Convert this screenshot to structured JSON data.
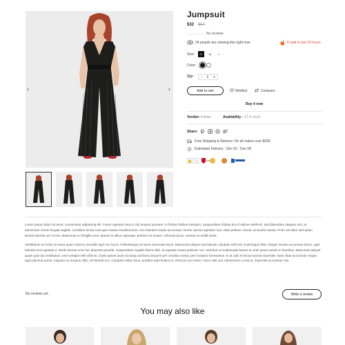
{
  "product": {
    "title": "Jumpsuit",
    "price": "$32",
    "old_price": "$54",
    "rating_stars": "☆☆☆☆☆",
    "reviews_label": "No reviews",
    "viewing_text": "24 people are viewing this right now",
    "sold_text": "6 sold in last 24 hours",
    "size_label": "Size:",
    "sizes": [
      "S",
      "M",
      "L"
    ],
    "color_label": "Color:",
    "qty_label": "Qty:",
    "qty_value": "1",
    "qty_minus": "-",
    "qty_plus": "+",
    "add_to_cart": "Add to cart",
    "wishlist": "Wishlist",
    "compare": "Compare",
    "buy_now": "Buy it now",
    "vendor_label": "Vendor:",
    "vendor_value": "Adidas",
    "availability_label": "Availability :",
    "availability_value": "23 in stock",
    "share_label": "Share:",
    "shipping_text": "Free Shipping & Returns: On all orders over $200",
    "delivery_text": "Estimated Delivery : Dec 02 - Dec 08"
  },
  "gallery": {
    "prev_arrow": "‹",
    "next_arrow": "›",
    "thumb_count": 5
  },
  "description": {
    "para1": "Lorem ipsum dolor sit amet, consectetur adipiscing elit. Fusce egestas risus in dui tempus posuere. In finibus finibus interdum. Suspendisse finibus dui id ultrices eleifend. Sed bibendum aliquam nisi, at elementum lorem feugiat sagittis. Curabitur luctus erat quis massa condimentum, non interdum turpis accumsan. Donec lacinia egestas nunc vitae pretium. Donec at iaculis massa. Proin vel diam sed quam lacinia lobortis nec id nisi. Maecenas eu fringilla eros. Mauris in tellus vulputate, pretium mi ornare, vehicula lacus. Aenean et mollis dolor.",
    "para2": "Vestibulum eu tortor sit amet quam viverra convallis eget nec lacus. Pellentesque sit amet venenatis lacus. Maecenas aliquet erat blandit, volutpat velit sed, scelerisque felis. Integer lacinia accumsan lorem, eget lobortis eros egestas a. Morbi laoreet eros nec pharetra gravida. Suspendisse sagittis libero nibh, at egestas metus pulvinar non. Interdum et malesuada fames ac ante ipsum primis in faucibus. Maecenas aliquet quam quis dui vestibulum, sed volutpat velit ultrices. Class aptent taciti sociosqu ad litora torquent per conubia nostra, per inceptos himenaeos. In at odio et lectus lacinia imperdiet. Nam vitae accumsan neque, eget placerat purus. Aliquam eu tempus nibh, vel blandit orci. Curabitur tellus risus, porttitor eget finibus et, rhoncus non lorem. Nunc velit nisl, elementum a erat et, imperdiet accumsan nisi."
  },
  "reviews": {
    "no_reviews": "No reviews yet",
    "write_review": "Write a review"
  },
  "recommendations": {
    "heading": "You may also like"
  },
  "colors": {
    "accent_sale": "#e8443a",
    "fire_icon": "#f26b1d",
    "dress": "#1d1d1b",
    "hair": "#a8432a"
  }
}
